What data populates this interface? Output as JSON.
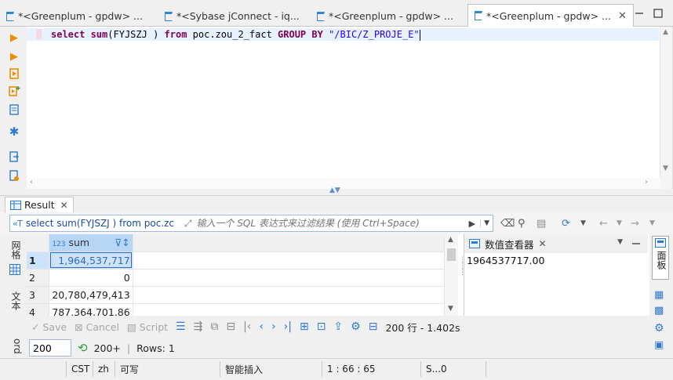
{
  "tabs": [
    {
      "label": "*<Greenplum - gpdw> ...",
      "active": false
    },
    {
      "label": "*<Sybase jConnect - iq...",
      "active": false
    },
    {
      "label": "*<Greenplum - gpdw> ...",
      "active": false
    },
    {
      "label": "*<Greenplum - gpdw> ...",
      "active": true
    }
  ],
  "editor": {
    "tokens": [
      {
        "t": "select ",
        "c": "kw"
      },
      {
        "t": "sum",
        "c": "kw"
      },
      {
        "t": "(FYJSZJ ) ",
        "c": "plain"
      },
      {
        "t": "from",
        "c": "kw"
      },
      {
        "t": " poc.zou_2_fact ",
        "c": "plain"
      },
      {
        "t": "GROUP",
        "c": "kw"
      },
      {
        "t": " ",
        "c": "plain"
      },
      {
        "t": "BY",
        "c": "kw"
      },
      {
        "t": " ",
        "c": "plain"
      },
      {
        "t": "\"/BIC/Z_PROJE_E\"",
        "c": "str"
      }
    ]
  },
  "result": {
    "tab_label": "Result",
    "query_tag": "select sum(FYJSZJ ) from poc.zc",
    "filter_placeholder": "输入一个 SQL 表达式来过滤结果 (使用 Ctrl+Space)",
    "vtab_grid": "网格",
    "vtab_text": "文本",
    "vtab_record": "ord",
    "column_header": "sum",
    "column_type": "123",
    "rows": [
      {
        "num": "1",
        "value": "1,964,537,717"
      },
      {
        "num": "2",
        "value": "0"
      },
      {
        "num": "3",
        "value": "20,780,479,413"
      },
      {
        "num": "4",
        "value": "787,364,701.86"
      }
    ]
  },
  "value_viewer": {
    "title": "数值查看器",
    "value": "1964537717.00",
    "side_tab": "面板"
  },
  "actions": {
    "save": "Save",
    "cancel": "Cancel",
    "script": "Script",
    "fetch_info": "200 行 - 1.402s"
  },
  "limit": {
    "value": "200",
    "fetch_next": "200+",
    "rows": "Rows: 1"
  },
  "status": {
    "timezone": "CST",
    "locale": "zh",
    "mode": "可写",
    "insert": "智能插入",
    "position": "1 : 66 : 65",
    "selection": "S...0"
  }
}
